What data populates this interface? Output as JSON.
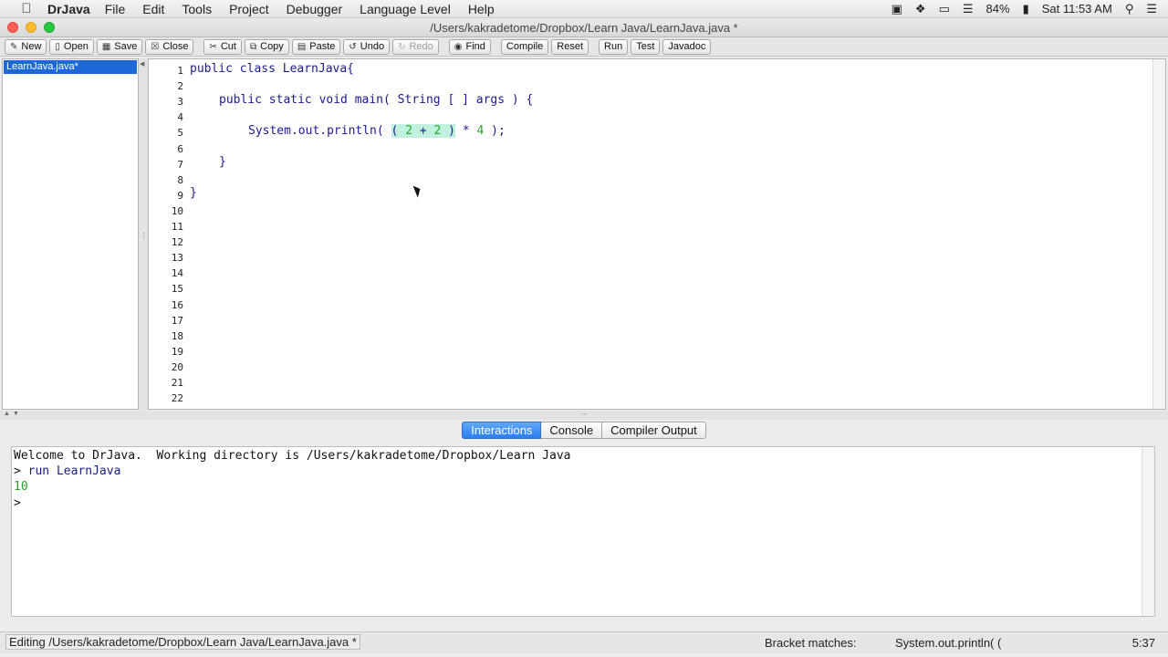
{
  "menubar": {
    "app_name": "DrJava",
    "menus": [
      "File",
      "Edit",
      "Tools",
      "Project",
      "Debugger",
      "Language Level",
      "Help"
    ],
    "battery": "84%",
    "clock": "Sat 11:53 AM"
  },
  "window": {
    "title": "/Users/kakradetome/Dropbox/Learn Java/LearnJava.java *"
  },
  "toolbar": {
    "new": "New",
    "open": "Open",
    "save": "Save",
    "close": "Close",
    "cut": "Cut",
    "copy": "Copy",
    "paste": "Paste",
    "undo": "Undo",
    "redo": "Redo",
    "find": "Find",
    "compile": "Compile",
    "reset": "Reset",
    "run": "Run",
    "test": "Test",
    "javadoc": "Javadoc"
  },
  "documents": [
    "LearnJava.java*"
  ],
  "editor": {
    "line_numbers": [
      "1",
      "2",
      "3",
      "4",
      "5",
      "6",
      "7",
      "8",
      "9",
      "10",
      "11",
      "12",
      "13",
      "14",
      "15",
      "16",
      "17",
      "18",
      "19",
      "20",
      "21",
      "22"
    ],
    "line1": "public class LearnJava{",
    "line3": "public static void main( String [ ] args ) {",
    "line5_pre": "System.out.println( ",
    "line5_open": "( ",
    "line5_a": "2",
    "line5_plus": " + ",
    "line5_b": "2",
    "line5_close": " )",
    "line5_mul": " * ",
    "line5_c": "4",
    "line5_end": " );",
    "line7": "}",
    "line9": "}"
  },
  "tabs": [
    "Interactions",
    "Console",
    "Compiler Output"
  ],
  "active_tab": "Interactions",
  "interactions": {
    "welcome": "Welcome to DrJava.  Working directory is /Users/kakradetome/Dropbox/Learn Java",
    "prompt1": "> ",
    "command": "run LearnJava",
    "output": "10",
    "prompt2": ">"
  },
  "statusbar": {
    "editing": "Editing /Users/kakradetome/Dropbox/Learn Java/LearnJava.java *",
    "bracket_label": "Bracket matches:",
    "bracket_value": "System.out.println( (",
    "position": "5:37"
  },
  "colors": {
    "keyword": "#1b1b8f",
    "number": "#2aa52a",
    "bracket_match": "#bff1df",
    "selection": "#1c68d6"
  }
}
